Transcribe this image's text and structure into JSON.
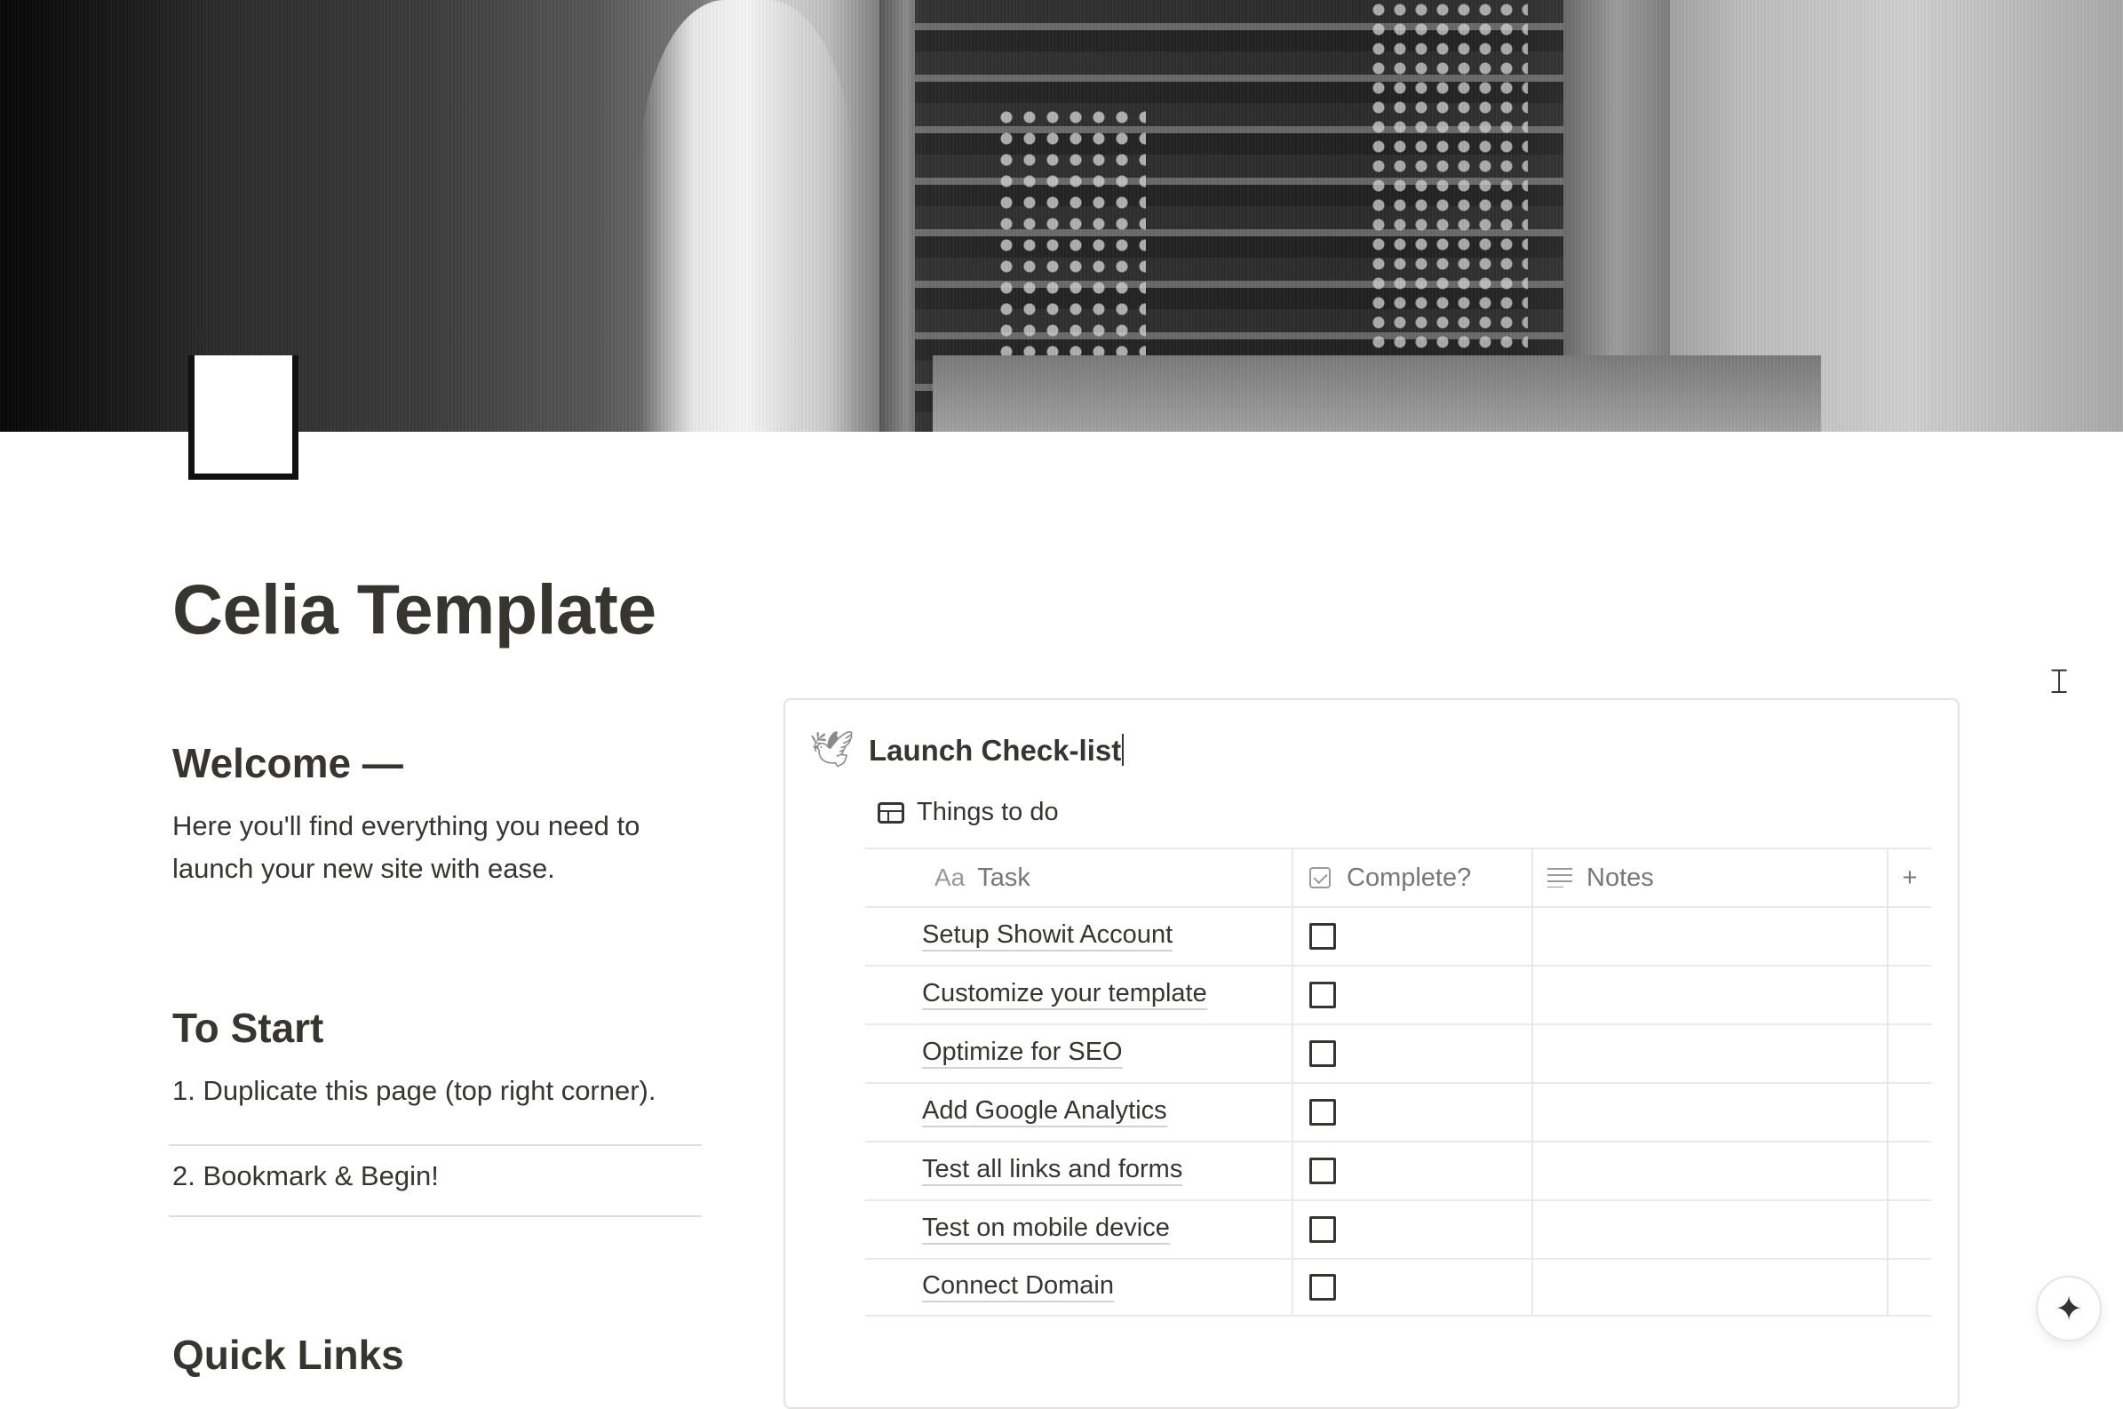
{
  "page": {
    "title": "Celia Template"
  },
  "welcome": {
    "heading": "Welcome —",
    "text": "Here you'll find everything you need to launch your new site with ease."
  },
  "to_start": {
    "heading": "To Start",
    "items": [
      "1. Duplicate this page (top right corner).",
      "2. Bookmark & Begin!"
    ]
  },
  "quick_links": {
    "heading": "Quick Links"
  },
  "checklist": {
    "icon": "dove-icon",
    "title": "Launch Check-list",
    "view_name": "Things to do",
    "columns": {
      "task": "Task",
      "task_icon": "Aa",
      "complete": "Complete?",
      "notes": "Notes",
      "add": "+"
    },
    "rows": [
      {
        "task": "Setup Showit Account",
        "complete": false,
        "notes": ""
      },
      {
        "task": "Customize your template",
        "complete": false,
        "notes": ""
      },
      {
        "task": "Optimize for SEO",
        "complete": false,
        "notes": ""
      },
      {
        "task": "Add Google Analytics",
        "complete": false,
        "notes": ""
      },
      {
        "task": "Test all links and forms",
        "complete": false,
        "notes": ""
      },
      {
        "task": "Test on mobile device",
        "complete": false,
        "notes": ""
      },
      {
        "task": "Connect Domain",
        "complete": false,
        "notes": ""
      }
    ]
  },
  "icons": {
    "ai": "sparkle-icon",
    "cursor": "text-cursor-icon"
  },
  "colors": {
    "text": "#37352f",
    "muted": "#787774",
    "border": "#e9e9e7"
  }
}
